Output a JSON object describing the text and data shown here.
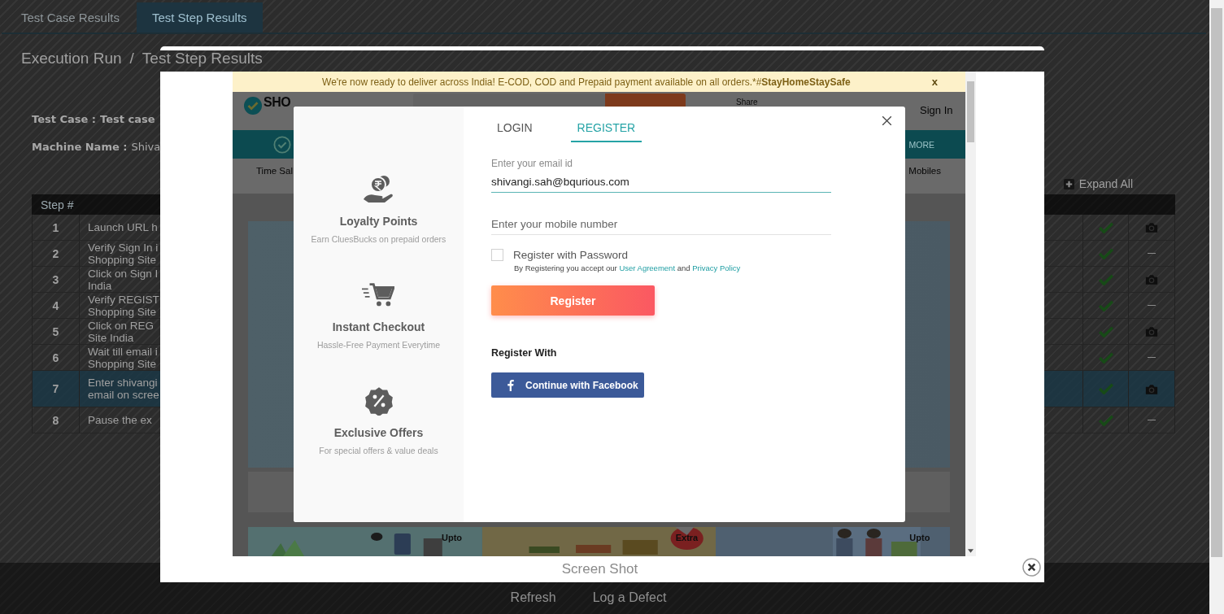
{
  "tabs": [
    {
      "label": "Test Case Results",
      "selected": false
    },
    {
      "label": "Test Step Results",
      "selected": true
    }
  ],
  "breadcrumb": [
    "Execution Run",
    "/",
    "Test Step Results"
  ],
  "details": [
    {
      "label": "Test Case :",
      "value": "Test case"
    },
    {
      "label": "Machine Name :",
      "value": "Shiva"
    }
  ],
  "expand_all": "Expand All",
  "steps_table": {
    "columns": [
      "Step #"
    ],
    "rows": [
      {
        "step": "1",
        "description": [
          "Launch URL h"
        ],
        "passed": true,
        "has_screenshot": true,
        "selected": false
      },
      {
        "step": "2",
        "description": [
          "Verify Sign In i",
          "Shopping Site"
        ],
        "passed": true,
        "has_screenshot": false,
        "selected": false
      },
      {
        "step": "3",
        "description": [
          "Click on Sign I",
          "India"
        ],
        "passed": true,
        "has_screenshot": true,
        "selected": false
      },
      {
        "step": "4",
        "description": [
          "Verify REGIST",
          "Shopping Site"
        ],
        "passed": true,
        "has_screenshot": false,
        "selected": false
      },
      {
        "step": "5",
        "description": [
          "Click on REG",
          "Site India"
        ],
        "passed": true,
        "has_screenshot": true,
        "selected": false
      },
      {
        "step": "6",
        "description": [
          "Wait till email i",
          "Shopping Site"
        ],
        "passed": true,
        "has_screenshot": false,
        "selected": false
      },
      {
        "step": "7",
        "description": [
          "Enter shivangi",
          "email on scree"
        ],
        "passed": true,
        "has_screenshot": true,
        "selected": true
      },
      {
        "step": "8",
        "description": [
          "Pause the ex"
        ],
        "passed": true,
        "has_screenshot": false,
        "selected": false
      }
    ]
  },
  "footer_actions": [
    "Refresh",
    "Log a Defect"
  ],
  "lightbox": {
    "caption": "Screen Shot",
    "screenshot": {
      "promo": {
        "text": "We're now ready to deliver across India! E-COD, COD and Prepaid payment available on all orders.*#**StayHomeStaySafe**",
        "close": "x"
      },
      "header": {
        "logo": "SHO",
        "share": "Share",
        "sign_in": "Sign In"
      },
      "nav": {
        "more": "MORE"
      },
      "categories": [
        "Time Sal",
        "Mobiles"
      ],
      "offers": [
        {
          "text": "Upto"
        },
        {
          "text": "Extra"
        },
        {
          "text": "Upto"
        }
      ],
      "modal": {
        "features": [
          {
            "kind": "coins",
            "title": "Loyalty Points",
            "subtitle": "Earn CluesBucks on prepaid orders"
          },
          {
            "kind": "cart",
            "title": "Instant Checkout",
            "subtitle": "Hassle-Free Payment Everytime"
          },
          {
            "kind": "percent",
            "title": "Exclusive Offers",
            "subtitle": "For special offers & value deals"
          }
        ],
        "tabs": [
          {
            "label": "LOGIN",
            "selected": false
          },
          {
            "label": "REGISTER",
            "selected": true
          }
        ],
        "email": {
          "label": "Enter your email id",
          "value": "shivangi.sah@bqurious.com"
        },
        "mobile": {
          "placeholder": "Enter your mobile number"
        },
        "password_option": {
          "label": "Register with Password",
          "checked": false
        },
        "terms": [
          {
            "kind": "text",
            "text": "By Registering you accept our"
          },
          {
            "kind": "link",
            "text": "User Agreement"
          },
          {
            "kind": "text",
            "text": "and"
          },
          {
            "kind": "link",
            "text": "Privacy Policy"
          }
        ],
        "register_button": "Register",
        "register_with": "Register With",
        "facebook_button": "Continue with Facebook"
      }
    }
  }
}
